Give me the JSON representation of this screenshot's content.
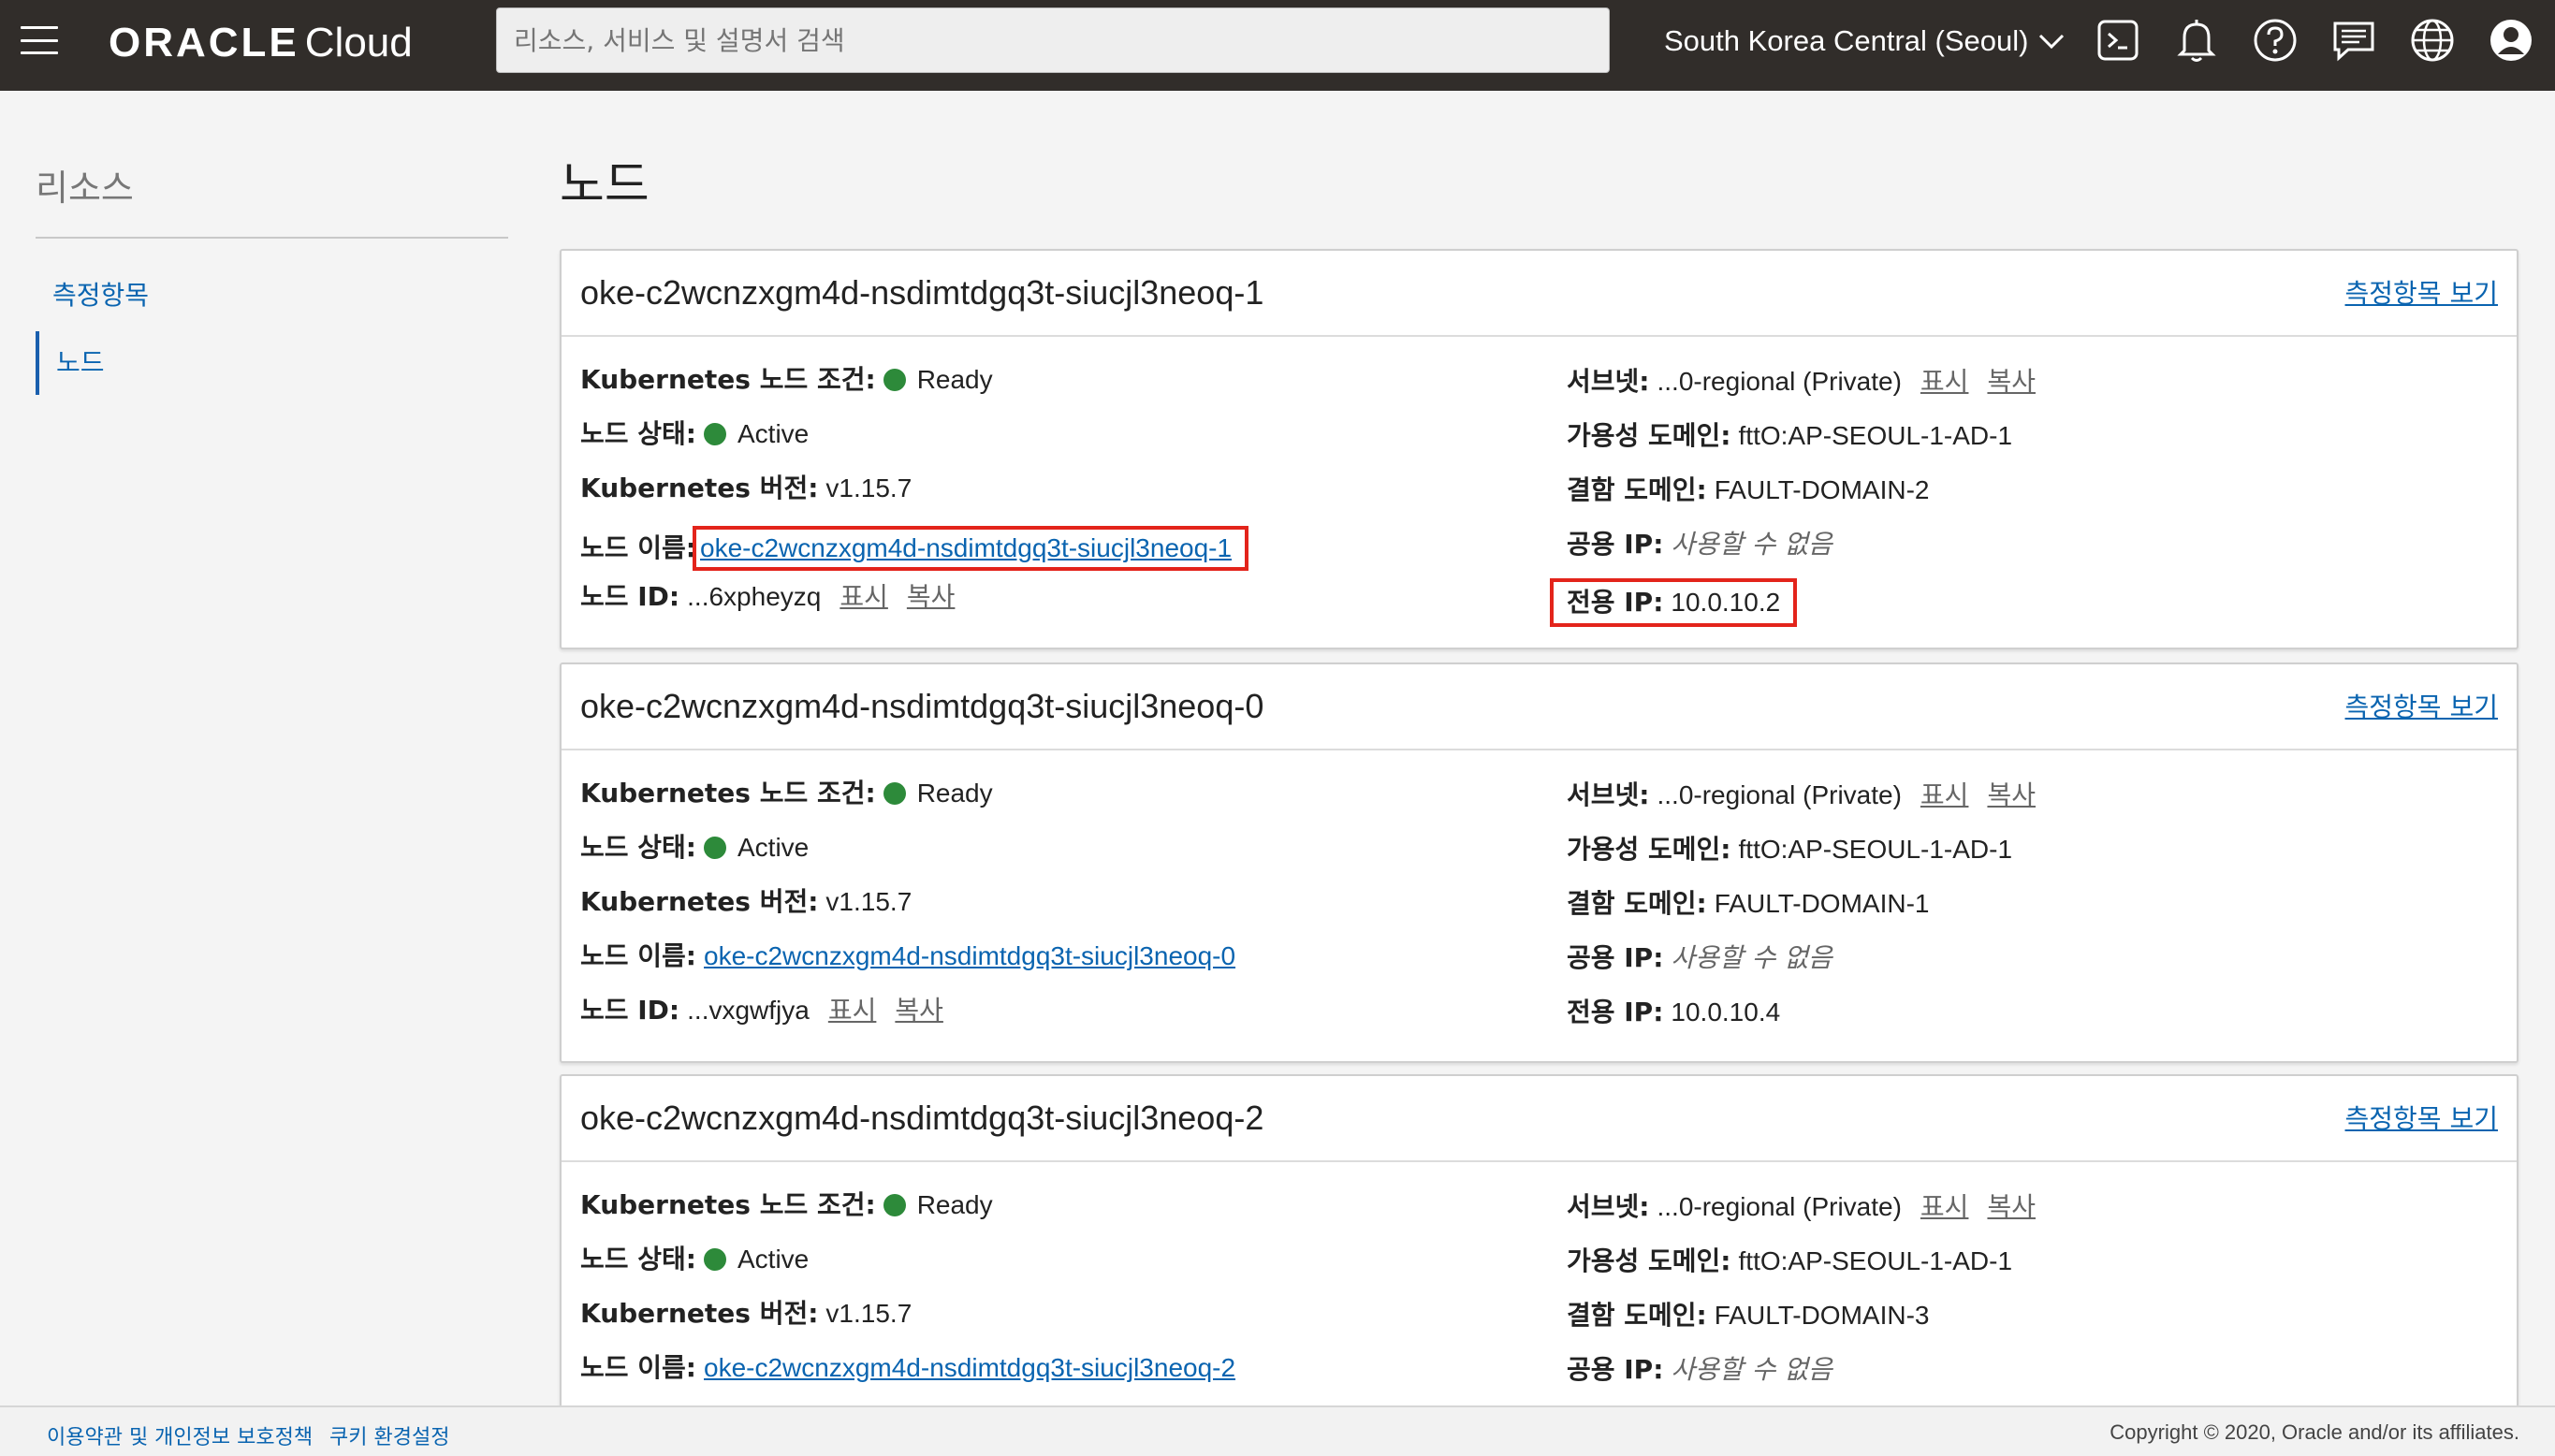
{
  "header": {
    "brand": "ORACLE",
    "product": "Cloud",
    "search_placeholder": "리소스, 서비스 및 설명서 검색",
    "region": "South Korea Central (Seoul)"
  },
  "sidebar": {
    "title": "리소스",
    "items": [
      {
        "label": "측정항목"
      },
      {
        "label": "노드"
      }
    ]
  },
  "page": {
    "title": "노드"
  },
  "labels": {
    "k8s_condition": "Kubernetes 노드 조건:",
    "node_status": "노드 상태:",
    "k8s_version": "Kubernetes 버전:",
    "node_name": "노드 이름:",
    "node_id": "노드 ID:",
    "subnet": "서브넷:",
    "availability_domain": "가용성 도메인:",
    "fault_domain": "결함 도메인:",
    "public_ip": "공용 IP:",
    "private_ip": "전용 IP:",
    "show": "표시",
    "copy": "복사",
    "view_metrics": "측정항목 보기",
    "no_public_ip": "사용할 수 없음"
  },
  "nodes": [
    {
      "name": "oke-c2wcnzxgm4d-nsdimtdgq3t-siucjl3neoq-1",
      "condition": "Ready",
      "status": "Active",
      "version": "v1.15.7",
      "node_id": "...6xpheyzq",
      "subnet": "...0-regional (Private)",
      "availability_domain": "fttO:AP-SEOUL-1-AD-1",
      "fault_domain": "FAULT-DOMAIN-2",
      "private_ip": "10.0.10.2"
    },
    {
      "name": "oke-c2wcnzxgm4d-nsdimtdgq3t-siucjl3neoq-0",
      "condition": "Ready",
      "status": "Active",
      "version": "v1.15.7",
      "node_id": "...vxgwfjya",
      "subnet": "...0-regional (Private)",
      "availability_domain": "fttO:AP-SEOUL-1-AD-1",
      "fault_domain": "FAULT-DOMAIN-1",
      "private_ip": "10.0.10.4"
    },
    {
      "name": "oke-c2wcnzxgm4d-nsdimtdgq3t-siucjl3neoq-2",
      "condition": "Ready",
      "status": "Active",
      "version": "v1.15.7",
      "subnet": "...0-regional (Private)",
      "availability_domain": "fttO:AP-SEOUL-1-AD-1",
      "fault_domain": "FAULT-DOMAIN-3"
    }
  ],
  "footer": {
    "terms": "이용약관 및 개인정보 보호정책",
    "cookies": "쿠키 환경설정",
    "copyright": "Copyright © 2020, Oracle and/or its affiliates."
  },
  "colors": {
    "header_bg": "#312d2a",
    "link": "#0a64b0",
    "status_green": "#2d8a3a",
    "highlight_red": "#e3241b"
  },
  "icons": [
    "hamburger-menu-icon",
    "cloud-shell-icon",
    "bell-icon",
    "help-icon",
    "chat-icon",
    "globe-icon",
    "user-icon",
    "chevron-down-icon"
  ]
}
